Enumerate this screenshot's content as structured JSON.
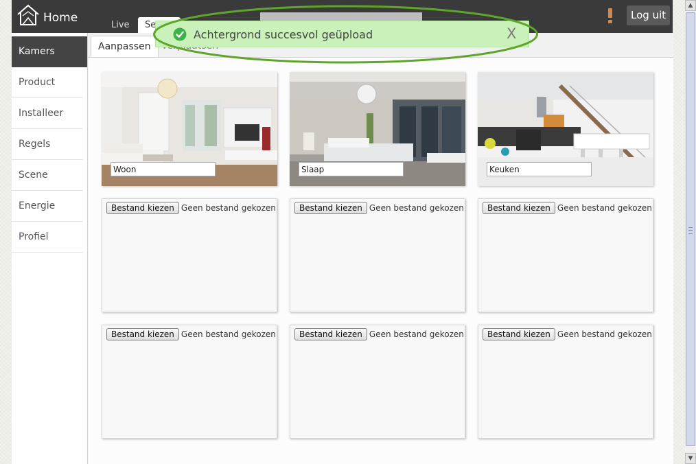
{
  "header": {
    "brand": "Home",
    "tabs": [
      {
        "label": "Live"
      },
      {
        "label": "Setu"
      }
    ],
    "logout_label": "Log uit"
  },
  "sidebar": {
    "items": [
      {
        "label": "Kamers",
        "active": true
      },
      {
        "label": "Product"
      },
      {
        "label": "Installeer"
      },
      {
        "label": "Regels"
      },
      {
        "label": "Scene"
      },
      {
        "label": "Energie"
      },
      {
        "label": "Profiel"
      }
    ]
  },
  "subtabs": [
    {
      "label": "Aanpassen"
    },
    {
      "label": "Verplaatsen"
    }
  ],
  "rooms": [
    {
      "name": "Woon"
    },
    {
      "name": "Slaap"
    },
    {
      "name": "Keuken"
    }
  ],
  "upload": {
    "button_label": "Bestand kiezen",
    "status": "Geen bestand gekozen"
  },
  "toast": {
    "message": "Achtergrond succesvol geüpload",
    "close": "X"
  },
  "colors": {
    "topbar": "#3a3a3a",
    "toast_bg": "#c9f1b9",
    "toast_ring": "#5ea52b",
    "success_icon": "#3cb34a"
  }
}
